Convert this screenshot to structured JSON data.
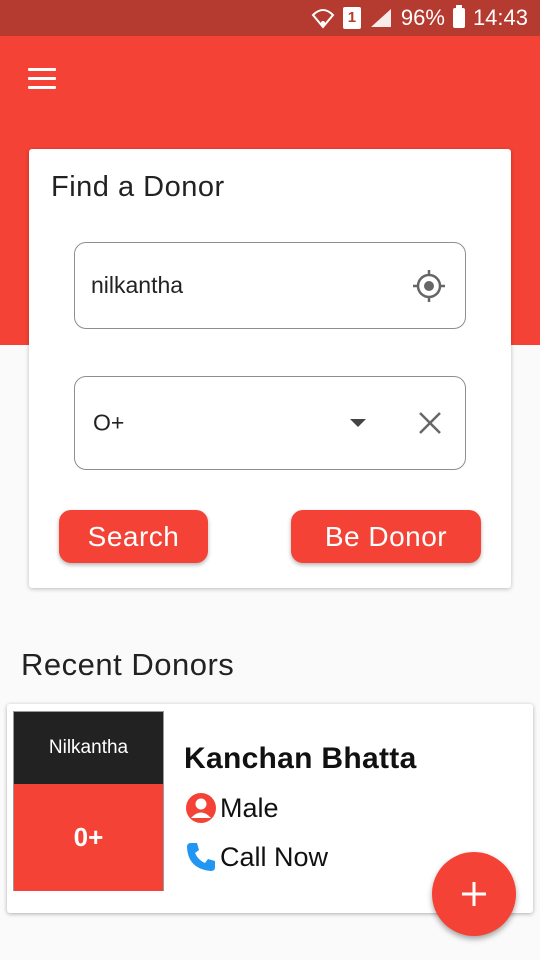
{
  "status_bar": {
    "wifi_icon": "wifi-icon",
    "sim_label": "1",
    "signal_icon": "signal-icon",
    "battery_percent": "96%",
    "battery_icon": "battery-icon",
    "time": "14:43"
  },
  "app_bar": {
    "menu_icon": "hamburger-menu-icon"
  },
  "colors": {
    "primary": "#f44336",
    "status_bar": "#b53a2f",
    "dark": "#222222",
    "call_icon": "#2196f3"
  },
  "find_donor": {
    "title": "Find a Donor",
    "location_value": "nilkantha",
    "location_icon": "my-location-icon",
    "blood_group_value": "O+",
    "dropdown_icon": "dropdown-caret-icon",
    "clear_icon": "close-icon",
    "search_label": "Search",
    "be_donor_label": "Be Donor"
  },
  "recent": {
    "title": "Recent Donors",
    "donors": [
      {
        "location": "Nilkantha",
        "blood_group": "0+",
        "name": "Kanchan Bhatta",
        "gender": "Male",
        "gender_icon": "person-icon",
        "call_label": "Call Now",
        "call_icon": "phone-icon"
      }
    ]
  },
  "fab": {
    "icon": "add-icon"
  }
}
